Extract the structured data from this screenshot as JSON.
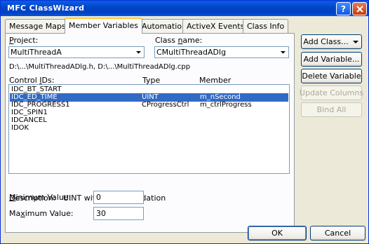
{
  "window": {
    "title": "MFC ClassWizard"
  },
  "tabs": [
    {
      "label": "Message Maps",
      "active": false
    },
    {
      "label": "Member Variables",
      "active": true
    },
    {
      "label": "Automation",
      "active": false
    },
    {
      "label": "ActiveX Events",
      "active": false
    },
    {
      "label": "Class Info",
      "active": false
    }
  ],
  "project": {
    "label": "Project:",
    "value": "MultiThreadA"
  },
  "class_name": {
    "label": "Class name:",
    "value": "CMultiThreadADlg"
  },
  "file_path": "D:\\...\\MultiThreadADlg.h, D:\\...\\MultiThreadADlg.cpp",
  "table": {
    "headers": {
      "id": "Control IDs:",
      "type": "Type",
      "member": "Member"
    },
    "rows": [
      {
        "id": "IDC_BT_START",
        "type": "",
        "member": "",
        "selected": false
      },
      {
        "id": "IDC_ED_TIME",
        "type": "UINT",
        "member": "m_nSecond",
        "selected": true
      },
      {
        "id": "IDC_PROGRESS1",
        "type": "CProgressCtrl",
        "member": "m_ctrlProgress",
        "selected": false
      },
      {
        "id": "IDC_SPIN1",
        "type": "",
        "member": "",
        "selected": false
      },
      {
        "id": "IDCANCEL",
        "type": "",
        "member": "",
        "selected": false
      },
      {
        "id": "IDOK",
        "type": "",
        "member": "",
        "selected": false
      }
    ]
  },
  "description": {
    "label": "Description:",
    "value": "UINT with range validation"
  },
  "min_value": {
    "label": "Minimum Value:",
    "value": "0"
  },
  "max_value": {
    "label": "Maximum Value:",
    "value": "30"
  },
  "buttons": {
    "add_class": "Add Class...",
    "add_variable": "Add Variable...",
    "delete_variable": "Delete Variable",
    "update_columns": "Update Columns",
    "bind_all": "Bind All",
    "ok": "OK",
    "cancel": "Cancel"
  },
  "colors": {
    "title_bar": "#0244c4",
    "selection": "#316ac5",
    "tab_highlight": "#ffc83c"
  }
}
